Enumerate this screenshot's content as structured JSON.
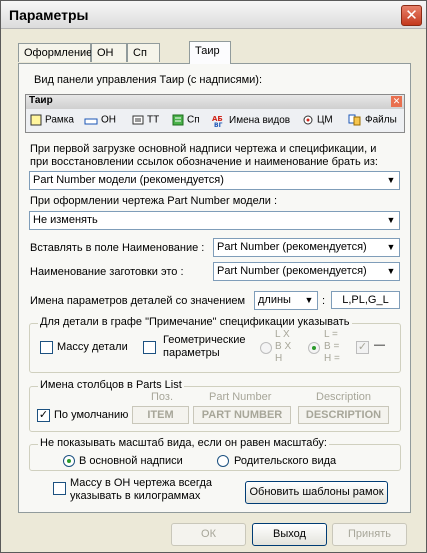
{
  "window": {
    "title": "Параметры",
    "close_glyph": "✕"
  },
  "tabs": [
    {
      "label": "Оформление"
    },
    {
      "label": "ОН"
    },
    {
      "label": "Сп"
    },
    {
      "label": "Таир"
    }
  ],
  "panel_view": {
    "label": "Вид панели управления Таир (с надписями):"
  },
  "toolbar": {
    "title": "Таир",
    "items": [
      {
        "label": "Рамка",
        "icon": "frame-icon"
      },
      {
        "label": "ОН",
        "icon": "title-block-icon"
      },
      {
        "label": "ТТ",
        "icon": "tech-requirements-icon"
      },
      {
        "label": "Сп",
        "icon": "spec-icon"
      },
      {
        "label": "Имена видов",
        "icon": "view-names-icon"
      },
      {
        "label": "ЦМ",
        "icon": "center-mass-icon"
      },
      {
        "label": "Файлы",
        "icon": "files-icon"
      }
    ]
  },
  "first_load": {
    "label_line1": "При первой загрузке основной надписи чертежа и спецификации, и",
    "label_line2": "при восстановлении ссылок обозначение и наименование брать из:",
    "value": "Part Number модели (рекомендуется)"
  },
  "drawing_pn": {
    "label": "При оформлении чертежа Part Number модели :",
    "value": "Не изменять"
  },
  "insert_name": {
    "label": "Вставлять в поле Наименование :",
    "value": "Part Number (рекомендуется)"
  },
  "blank_name": {
    "label": "Наименование заготовки это :",
    "value": "Part Number (рекомендуется)"
  },
  "param_names": {
    "label": "Имена параметров деталей со значением",
    "combo_value": "длины",
    "colon": ":",
    "edit_value": "L,PL,G_L"
  },
  "note_group": {
    "title": "Для детали в графе \"Примечание\" спецификации указывать",
    "mass_label": "Массу детали",
    "geom_label1": "Геометрические",
    "geom_label2": "параметры",
    "opt1_line1": "L X",
    "opt1_line2": "B X",
    "opt1_line3": "H",
    "opt2_line1": "L =",
    "opt2_line2": "B =",
    "opt2_line3": "H =",
    "opt3_label": "—"
  },
  "columns_group": {
    "title": "Имена столбцов в Parts List",
    "col_pos": "Поз.",
    "col_pn": "Part Number",
    "col_desc": "Description",
    "default_label": "По умолчанию",
    "item_value": "ITEM",
    "pn_value": "PART NUMBER",
    "desc_value": "DESCRIPTION"
  },
  "scale_group": {
    "title": "Не показывать масштаб вида, если он равен масштабу:",
    "opt_main": "В основной надписи",
    "opt_parent": "Родительского вида"
  },
  "mass_kg": {
    "line1": "Массу в ОН чертежа всегда",
    "line2": "указывать в килограммах"
  },
  "update_button": "Обновить шаблоны рамок",
  "footer": {
    "ok": "ОК",
    "exit": "Выход",
    "apply": "Принять"
  },
  "colors": {
    "accent": "#1c5180",
    "close_red": "#c4391d",
    "check_green": "#2b9a2b"
  }
}
